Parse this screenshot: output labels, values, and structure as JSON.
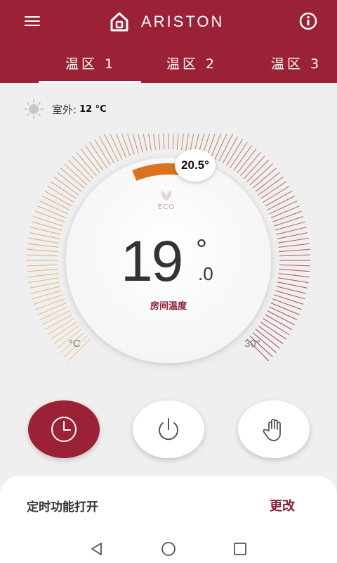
{
  "header": {
    "brand": "ARISTON",
    "tabs": [
      {
        "label": "温区 1",
        "active": true
      },
      {
        "label": "温区 2",
        "active": false
      },
      {
        "label": "温区 3",
        "active": false
      }
    ]
  },
  "outdoor": {
    "label": "室外:",
    "value": "12 °C"
  },
  "thermostat": {
    "setpoint": "20.5°",
    "eco_label": "ECO",
    "room_temp_int": "19",
    "room_temp_deg": "°",
    "room_temp_dec": ".0",
    "room_label": "房间温度",
    "scale_min": "°C",
    "scale_max": "30°"
  },
  "modes": [
    {
      "name": "schedule",
      "icon": "clock-icon",
      "active": true
    },
    {
      "name": "power",
      "icon": "power-icon",
      "active": false
    },
    {
      "name": "manual",
      "icon": "hand-icon",
      "active": false
    }
  ],
  "sheet": {
    "title": "定时功能打开",
    "action": "更改"
  },
  "colors": {
    "brand": "#9b2236",
    "arc_active": "#d9731f",
    "scale_cold": "#e9c06f",
    "scale_hot": "#9b2236"
  }
}
